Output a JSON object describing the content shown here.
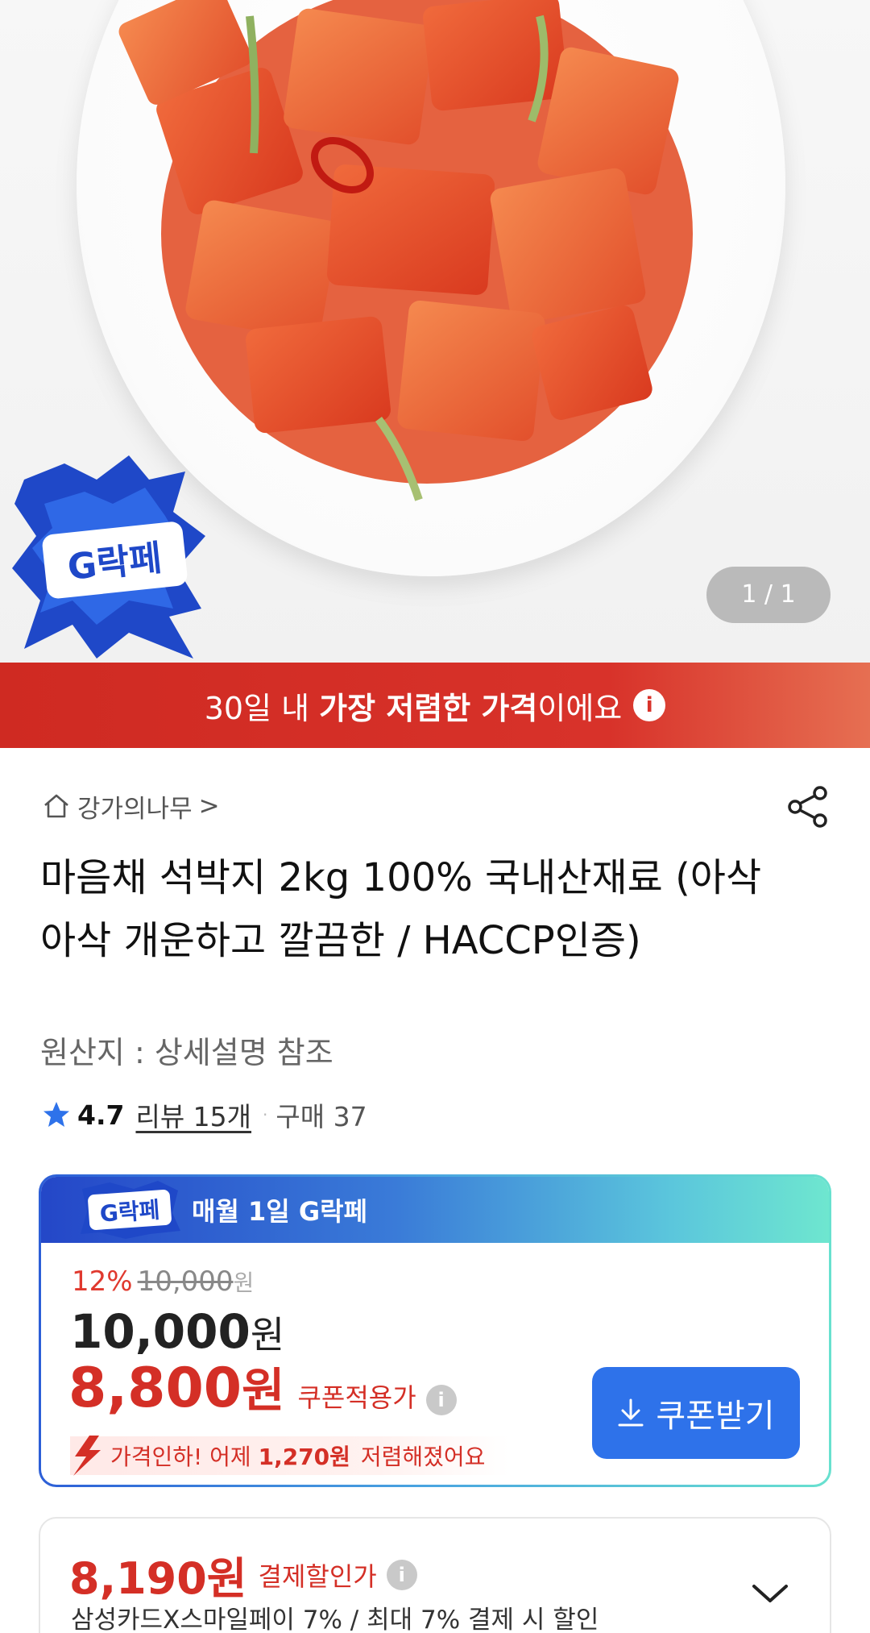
{
  "gallery": {
    "counter": "1 / 1",
    "badge_text": "G락페"
  },
  "banner": {
    "prefix": "30일 내 ",
    "highlight": "가장 저렴한 가격",
    "suffix": "이에요",
    "info_icon": "i"
  },
  "product": {
    "store_name": "강가의나무",
    "store_chevron": ">",
    "title": "마음채 석박지 2kg 100% 국내산재료 (아삭아삭 개운하고 깔끔한 / HACCP인증)",
    "origin": "원산지 : 상세설명 참조",
    "rating": "4.7",
    "reviews": "리뷰 15개",
    "separator": "·",
    "purchases": "구매 37"
  },
  "deal": {
    "logo_text": "G락페",
    "title": "매월 1일 G락페",
    "discount_pct": "12%",
    "original_price": "10,000",
    "original_won": "원",
    "price_num": "10,000",
    "price_won": "원",
    "coupon_price_num": "8,800",
    "coupon_price_won": "원",
    "coupon_label": "쿠폰적용가",
    "info_icon": "i",
    "drop_prefix": "가격인하! 어제 ",
    "drop_amount": "1,270원",
    "drop_suffix": " 저렴해졌어요",
    "coupon_button": "쿠폰받기"
  },
  "payment": {
    "price": "8,190원",
    "label": "결제할인가",
    "info_icon": "i",
    "description": "삼성카드X스마일페이 7% / 최대 7% 결제 시 할인"
  },
  "colors": {
    "brand_red": "#d42f26",
    "banner_red": "#d8322a",
    "coupon_blue": "#2e72ea",
    "deal_gradient_start": "#2447c8",
    "deal_gradient_end": "#6ee6cf"
  },
  "icons": {
    "home": "home-icon",
    "share": "share-icon",
    "star": "star-icon",
    "download": "download-icon",
    "chevron": "chevron-down-icon",
    "lightning": "lightning-down-icon"
  }
}
